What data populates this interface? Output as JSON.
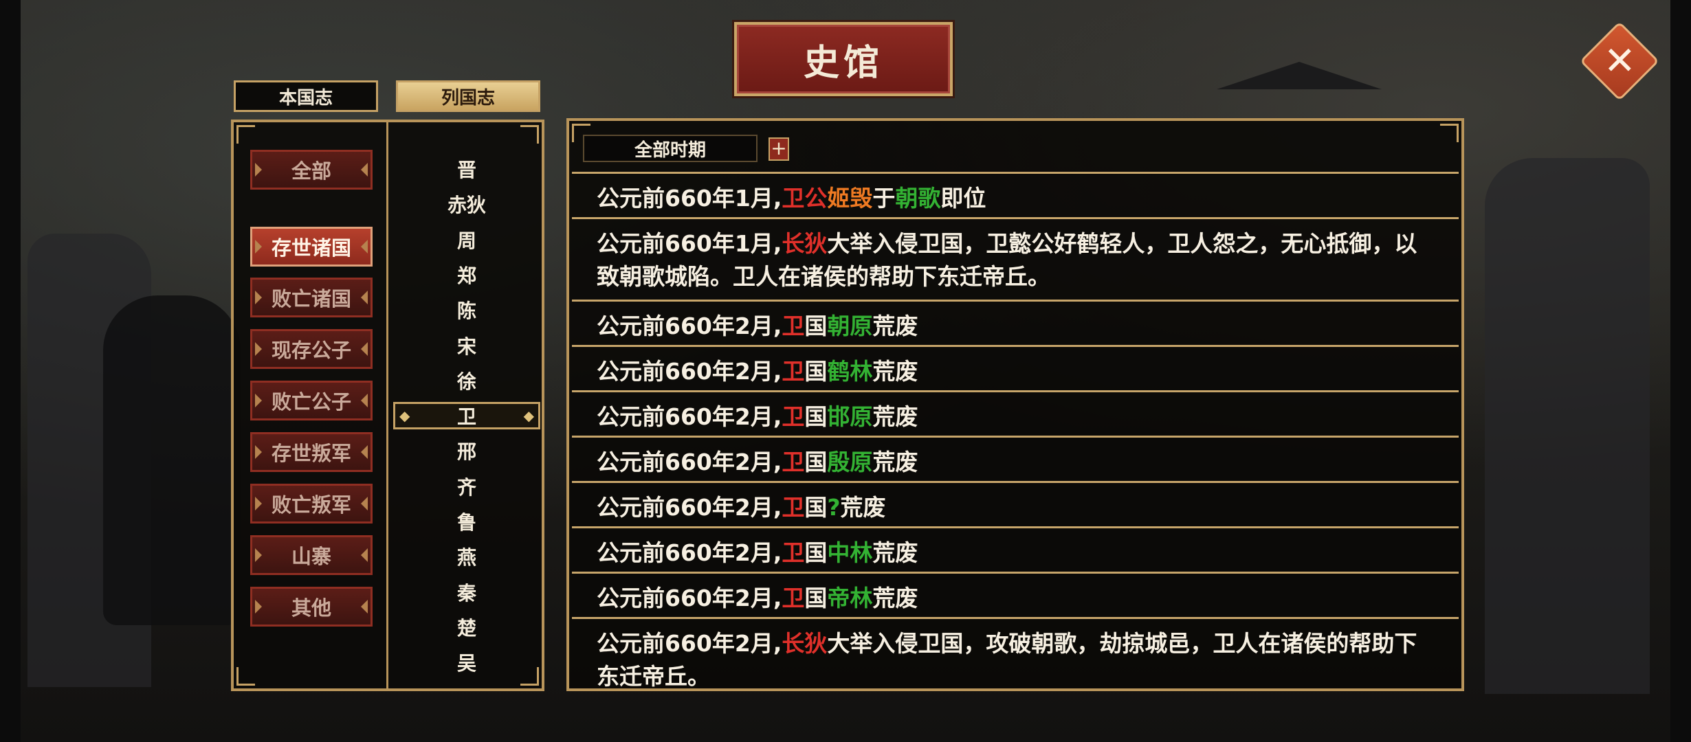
{
  "title": "史馆",
  "close_label": "✕",
  "tabs": [
    {
      "label": "本国志",
      "active": false
    },
    {
      "label": "列国志",
      "active": true
    }
  ],
  "categories": [
    {
      "label": "全部",
      "selected": false
    },
    {
      "label": "存世诸国",
      "selected": true
    },
    {
      "label": "败亡诸国",
      "selected": false
    },
    {
      "label": "现存公子",
      "selected": false
    },
    {
      "label": "败亡公子",
      "selected": false
    },
    {
      "label": "存世叛军",
      "selected": false
    },
    {
      "label": "败亡叛军",
      "selected": false
    },
    {
      "label": "山寨",
      "selected": false
    },
    {
      "label": "其他",
      "selected": false
    }
  ],
  "states": [
    {
      "label": "晋"
    },
    {
      "label": "赤狄"
    },
    {
      "label": "周"
    },
    {
      "label": "郑"
    },
    {
      "label": "陈"
    },
    {
      "label": "宋"
    },
    {
      "label": "徐"
    },
    {
      "label": "卫",
      "selected": true
    },
    {
      "label": "邢"
    },
    {
      "label": "齐"
    },
    {
      "label": "鲁"
    },
    {
      "label": "燕"
    },
    {
      "label": "秦"
    },
    {
      "label": "楚"
    },
    {
      "label": "吴"
    }
  ],
  "period": {
    "label": "全部时期",
    "plus": "+"
  },
  "records": [
    {
      "date": "公元前660年1月,",
      "parts": [
        [
          "卫公",
          "r"
        ],
        [
          "姬毁",
          "o"
        ],
        [
          "于",
          ""
        ],
        [
          "朝歌",
          "g"
        ],
        [
          "即位",
          ""
        ]
      ]
    },
    {
      "date": "公元前660年1月,",
      "parts": [
        [
          "长狄",
          "r"
        ],
        [
          "大举入侵卫国，卫懿公好鹤轻人，卫人怨之，无心抵御，以致朝歌城陷。卫人在诸侯的帮助下东迁帝丘。",
          ""
        ]
      ]
    },
    {
      "date": "公元前660年2月,",
      "parts": [
        [
          "卫",
          "r"
        ],
        [
          "国",
          ""
        ],
        [
          "朝原",
          "g"
        ],
        [
          "荒废",
          ""
        ]
      ]
    },
    {
      "date": "公元前660年2月,",
      "parts": [
        [
          "卫",
          "r"
        ],
        [
          "国",
          ""
        ],
        [
          "鹤林",
          "g"
        ],
        [
          "荒废",
          ""
        ]
      ]
    },
    {
      "date": "公元前660年2月,",
      "parts": [
        [
          "卫",
          "r"
        ],
        [
          "国",
          ""
        ],
        [
          "邯原",
          "g"
        ],
        [
          "荒废",
          ""
        ]
      ]
    },
    {
      "date": "公元前660年2月,",
      "parts": [
        [
          "卫",
          "r"
        ],
        [
          "国",
          ""
        ],
        [
          "殷原",
          "g"
        ],
        [
          "荒废",
          ""
        ]
      ]
    },
    {
      "date": "公元前660年2月,",
      "parts": [
        [
          "卫",
          "r"
        ],
        [
          "国",
          ""
        ],
        [
          "?",
          "g"
        ],
        [
          "荒废",
          ""
        ]
      ]
    },
    {
      "date": "公元前660年2月,",
      "parts": [
        [
          "卫",
          "r"
        ],
        [
          "国",
          ""
        ],
        [
          "中林",
          "g"
        ],
        [
          "荒废",
          ""
        ]
      ]
    },
    {
      "date": "公元前660年2月,",
      "parts": [
        [
          "卫",
          "r"
        ],
        [
          "国",
          ""
        ],
        [
          "帝林",
          "g"
        ],
        [
          "荒废",
          ""
        ]
      ]
    },
    {
      "date": "公元前660年2月,",
      "parts": [
        [
          "长狄",
          "r"
        ],
        [
          "大举入侵卫国，攻破朝歌，劫掠城邑，卫人在诸侯的帮助下东迁帝丘。",
          ""
        ]
      ]
    }
  ],
  "colors": {
    "accent_gold": "#c6a265",
    "name_red": "#e0302a",
    "name_orange": "#ef7a22",
    "place_green": "#33b233",
    "button_red": "#8e2a1d"
  }
}
